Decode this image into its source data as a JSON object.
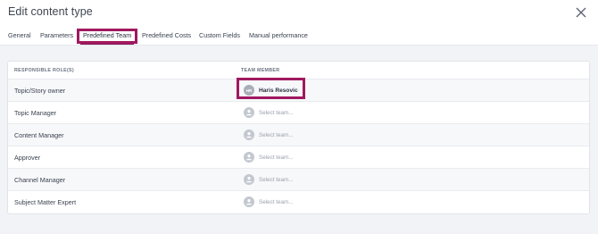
{
  "dialog": {
    "title": "Edit content type"
  },
  "tabs": [
    {
      "label": "General"
    },
    {
      "label": "Parameters"
    },
    {
      "label": "Predefined Team"
    },
    {
      "label": "Predefined Costs"
    },
    {
      "label": "Custom Fields"
    },
    {
      "label": "Manual performance"
    }
  ],
  "table": {
    "headers": {
      "role": "RESPONSIBLE ROLE(S)",
      "member": "TEAM MEMBER"
    },
    "rows": [
      {
        "role": "Topic/Story owner",
        "member": "Haris Resovic",
        "initials": "HR"
      },
      {
        "role": "Topic Manager",
        "member": "Select team..."
      },
      {
        "role": "Content Manager",
        "member": "Select team..."
      },
      {
        "role": "Approver",
        "member": "Select team..."
      },
      {
        "role": "Channel Manager",
        "member": "Select team..."
      },
      {
        "role": "Subject Matter Expert",
        "member": "Select team..."
      }
    ]
  },
  "colors": {
    "accent": "#a0195f",
    "background": "#f2f3f6"
  },
  "icons": {
    "close": "close-icon",
    "user": "user-icon"
  }
}
